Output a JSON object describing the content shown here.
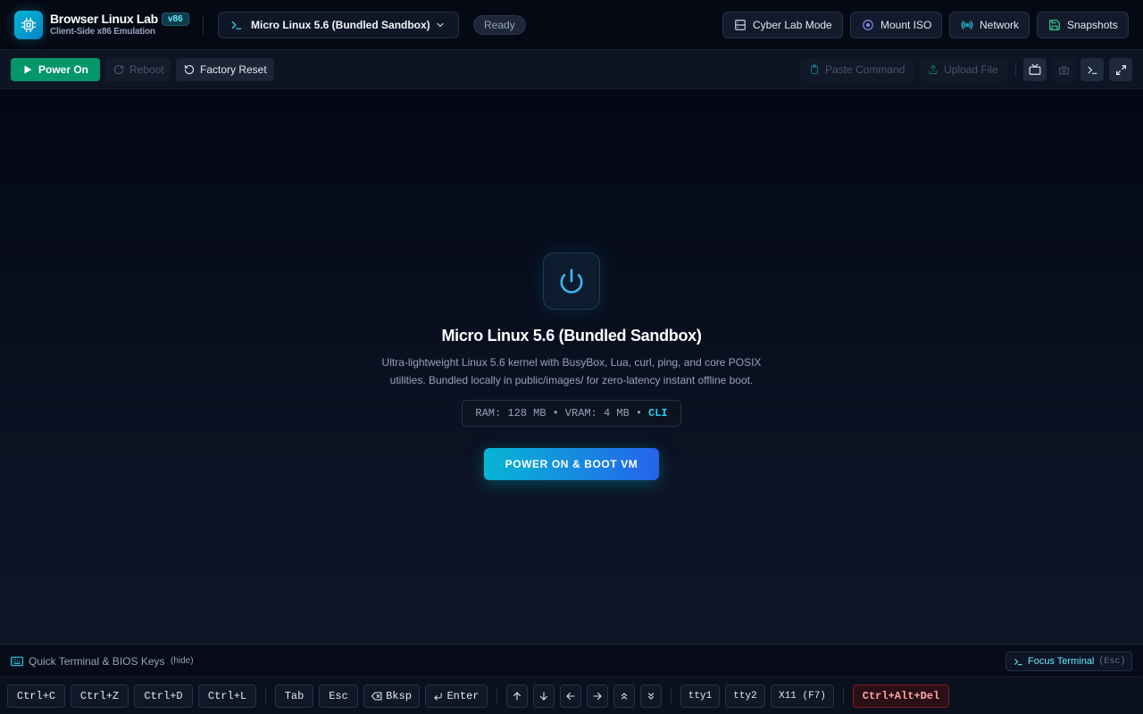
{
  "header": {
    "app_title": "Browser Linux Lab",
    "app_subtitle": "Client-Side x86 Emulation",
    "version": "v86",
    "os_selector": "Micro Linux 5.6 (Bundled Sandbox)",
    "status": "Ready",
    "buttons": {
      "cyber_lab": "Cyber Lab Mode",
      "mount_iso": "Mount ISO",
      "network": "Network",
      "snapshots": "Snapshots"
    }
  },
  "toolbar": {
    "power_on": "Power On",
    "reboot": "Reboot",
    "factory_reset": "Factory Reset",
    "paste_command": "Paste Command",
    "upload_file": "Upload File"
  },
  "main": {
    "os_title": "Micro Linux 5.6 (Bundled Sandbox)",
    "description_line1": "Ultra-lightweight Linux 5.6 kernel with BusyBox, Lua, curl, ping, and core POSIX",
    "description_line2": "utilities. Bundled locally in public/images/ for zero-latency instant offline boot.",
    "spec_ram": "RAM: 128 MB",
    "spec_vram": "VRAM: 4 MB",
    "spec_mode": "CLI",
    "spec_separator": "•",
    "boot_button": "POWER ON & BOOT VM"
  },
  "quick_keys": {
    "title": "Quick Terminal & BIOS Keys",
    "hide": "(hide)",
    "focus_terminal": "Focus Terminal",
    "focus_shortcut": "(Esc)",
    "keys": {
      "ctrl_c": "Ctrl+C",
      "ctrl_z": "Ctrl+Z",
      "ctrl_d": "Ctrl+D",
      "ctrl_l": "Ctrl+L",
      "tab": "Tab",
      "esc": "Esc",
      "bksp": "Bksp",
      "enter": "Enter",
      "tty1": "tty1",
      "tty2": "tty2",
      "x11": "X11 (F7)",
      "ctrl_alt_del": "Ctrl+Alt+Del"
    }
  },
  "colors": {
    "accent_cyan": "#06b6d4",
    "power_green": "#059669",
    "danger_red": "#fca5a5",
    "background": "#0a0f1e"
  },
  "icons": {
    "logo": "cpu-chip-icon",
    "os": "terminal-prompt-icon",
    "cyber_lab": "server-icon",
    "mount_iso": "disc-icon",
    "network": "broadcast-icon",
    "snapshots": "save-icon",
    "power": "power-icon"
  }
}
